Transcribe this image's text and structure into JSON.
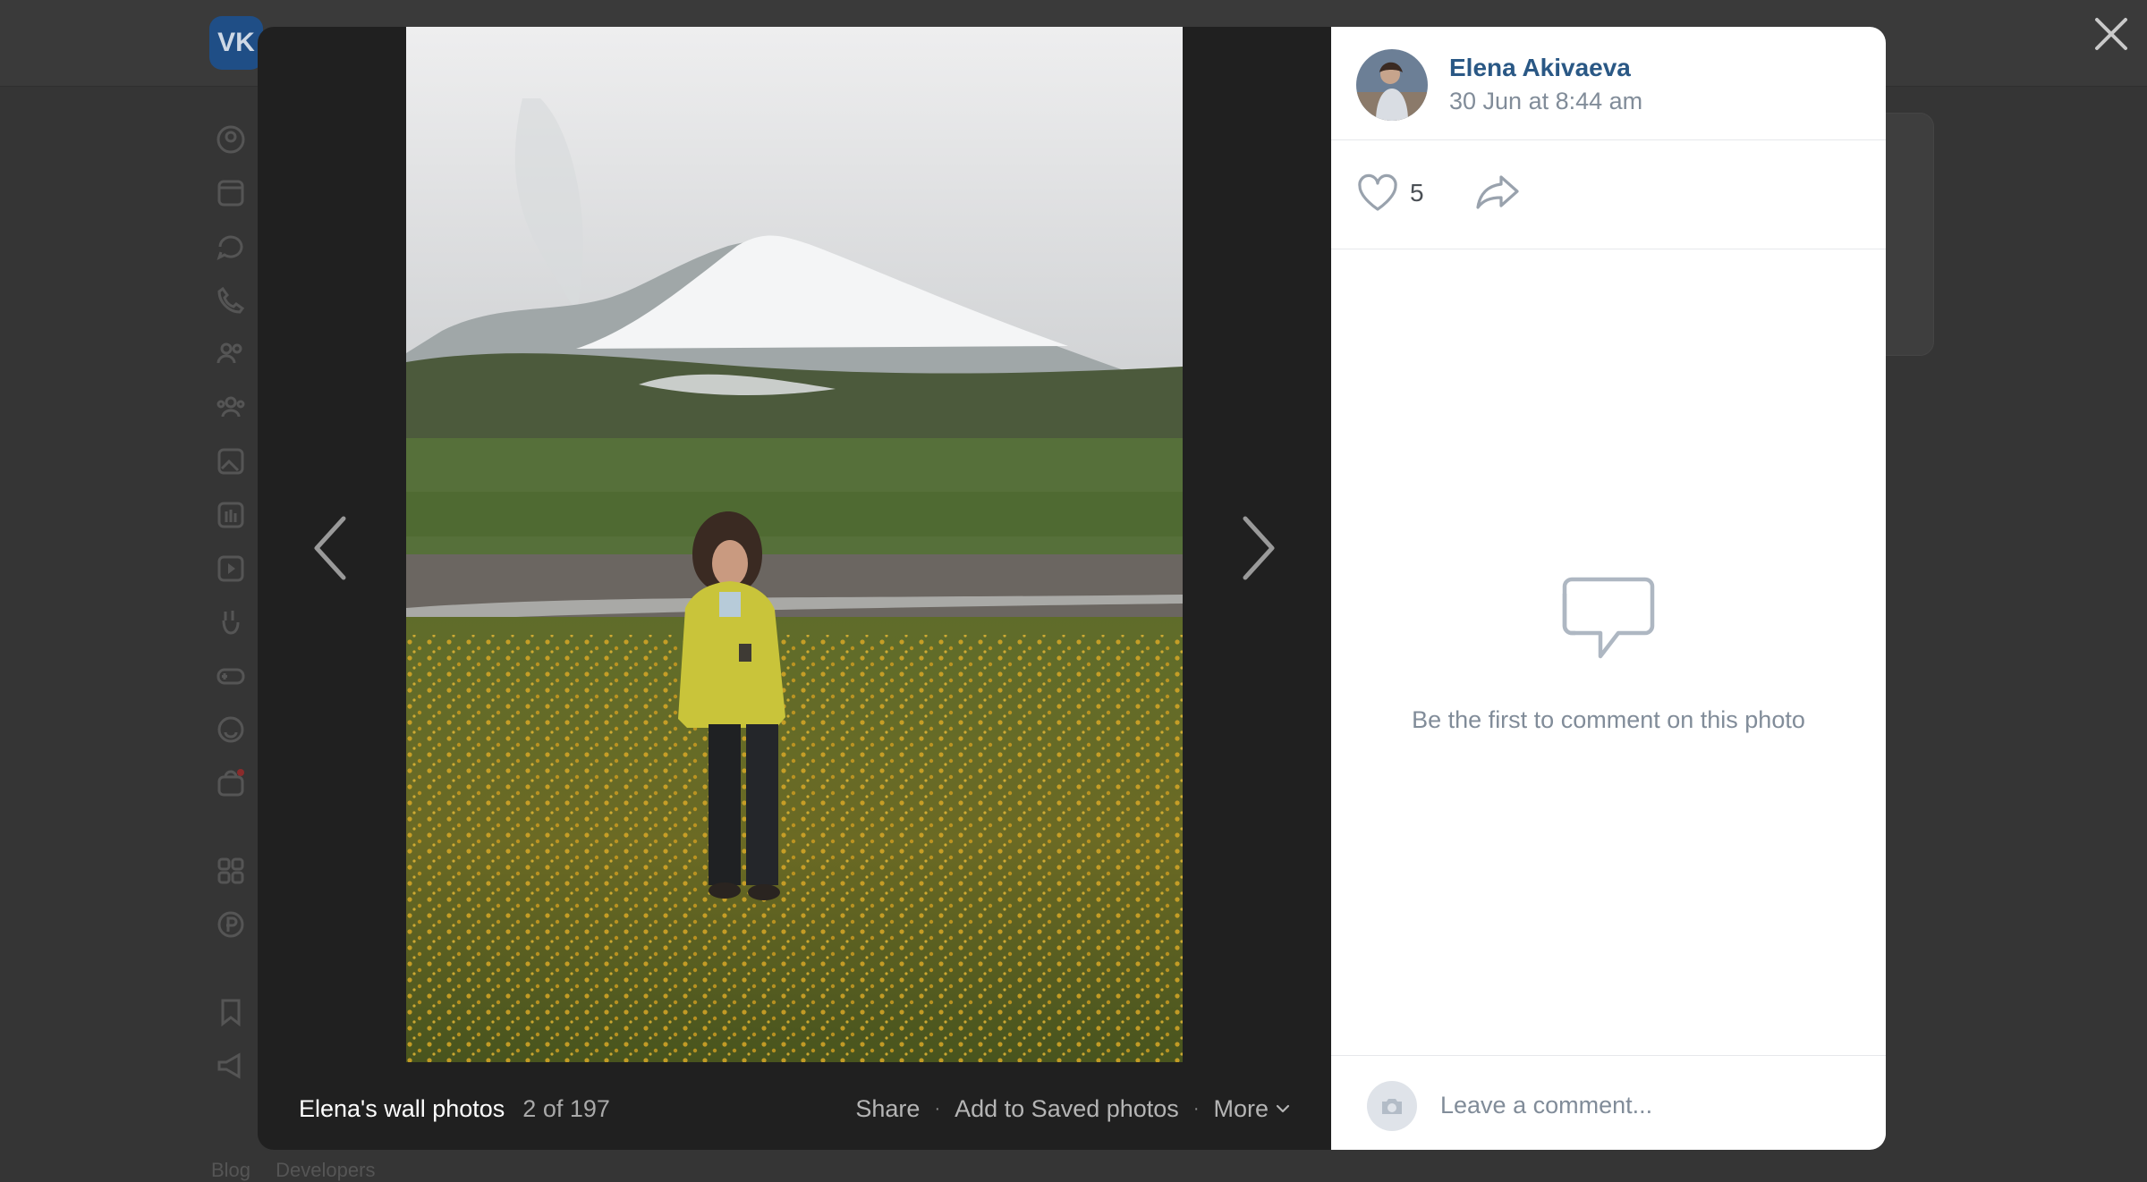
{
  "background": {
    "logo_text": "VK",
    "footer_links": [
      "Blog",
      "Developers"
    ]
  },
  "viewer": {
    "album_title": "Elena's wall photos",
    "counter": "2 of 197",
    "actions": {
      "share": "Share",
      "save": "Add to Saved photos",
      "more": "More",
      "separator": "·"
    }
  },
  "post": {
    "author_name": "Elena Akivaeva",
    "date": "30 Jun at 8:44 am",
    "likes": "5"
  },
  "comments": {
    "empty_text": "Be the first to comment on this photo",
    "input_placeholder": "Leave a comment..."
  },
  "colors": {
    "accent": "#2a5885",
    "secondary_text": "#818c99",
    "overlay": "#353535"
  }
}
